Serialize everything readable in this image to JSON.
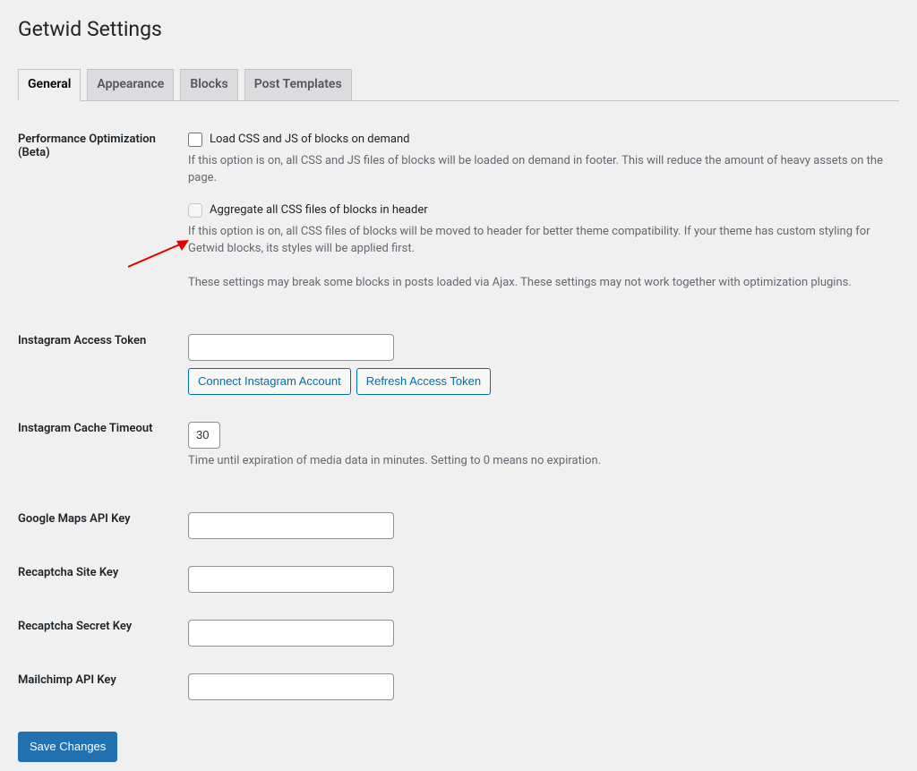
{
  "page": {
    "title": "Getwid Settings"
  },
  "tabs": {
    "general": "General",
    "appearance": "Appearance",
    "blocks": "Blocks",
    "post_templates": "Post Templates"
  },
  "fields": {
    "perf_opt": {
      "label": "Performance Optimization (Beta)",
      "checkbox1_label": "Load CSS and JS of blocks on demand",
      "checkbox1_desc": "If this option is on, all CSS and JS files of blocks will be loaded on demand in footer. This will reduce the amount of heavy assets on the page.",
      "checkbox2_label": "Aggregate all CSS files of blocks in header",
      "checkbox2_desc": "If this option is on, all CSS files of blocks will be moved to header for better theme compatibility. If your theme has custom styling for Getwid blocks, its styles will be applied first.",
      "note": "These settings may break some blocks in posts loaded via Ajax. These settings may not work together with optimization plugins."
    },
    "instagram_token": {
      "label": "Instagram Access Token",
      "value": "",
      "connect_btn": "Connect Instagram Account",
      "refresh_btn": "Refresh Access Token"
    },
    "instagram_cache": {
      "label": "Instagram Cache Timeout",
      "value": "30",
      "desc": "Time until expiration of media data in minutes. Setting to 0 means no expiration."
    },
    "google_maps": {
      "label": "Google Maps API Key",
      "value": ""
    },
    "recaptcha_site": {
      "label": "Recaptcha Site Key",
      "value": ""
    },
    "recaptcha_secret": {
      "label": "Recaptcha Secret Key",
      "value": ""
    },
    "mailchimp": {
      "label": "Mailchimp API Key",
      "value": ""
    }
  },
  "save_button": "Save Changes"
}
